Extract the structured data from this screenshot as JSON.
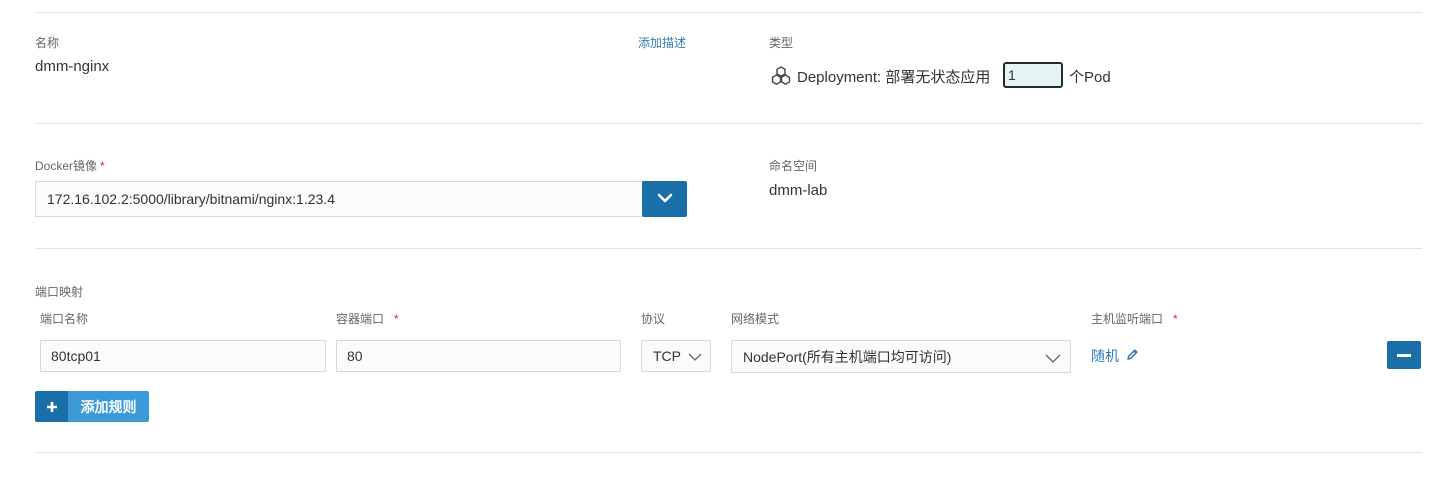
{
  "basic": {
    "name_label": "名称",
    "name_value": "dmm-nginx",
    "add_description": "添加描述",
    "type_label": "类型",
    "type_prefix": "Deployment: 部署无状态应用",
    "replicas": "1",
    "replicas_suffix": "个Pod"
  },
  "image": {
    "label": "Docker镜像",
    "required_mark": "*",
    "value": "172.16.102.2:5000/library/bitnami/nginx:1.23.4"
  },
  "namespace": {
    "label": "命名空间",
    "value": "dmm-lab"
  },
  "ports": {
    "section_label": "端口映射",
    "headers": {
      "name": "端口名称",
      "container_port": "容器端口",
      "protocol": "协议",
      "network_mode": "网络模式",
      "host_port": "主机监听端口"
    },
    "required_mark": "*",
    "rows": [
      {
        "name": "80tcp01",
        "container_port": "80",
        "protocol": "TCP",
        "network_mode": "NodePort(所有主机端口均可访问)",
        "host_port": "随机"
      }
    ],
    "add_rule": "添加规则"
  },
  "icons": {
    "deployment": "deployment-icon",
    "chevron": "chevron-down-icon",
    "pencil": "pencil-icon",
    "minus": "minus-icon",
    "plus": "plus-icon"
  },
  "colors": {
    "primary": "#1b6fa8",
    "add_button_light": "#3d9ad9",
    "link": "#2f7ab8",
    "required": "#c0392b",
    "replica_input_bg": "#e6f4f4"
  }
}
